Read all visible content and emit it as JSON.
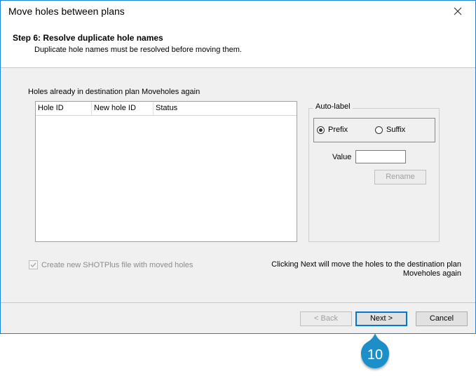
{
  "window": {
    "title": "Move holes between plans"
  },
  "header": {
    "step_title": "Step 6: Resolve duplicate hole names",
    "step_subtitle": "Duplicate hole names must be resolved before moving them."
  },
  "list": {
    "label": "Holes already in destination plan Moveholes again",
    "columns": [
      "Hole ID",
      "New hole ID",
      "Status"
    ],
    "rows": []
  },
  "auto_label": {
    "title": "Auto-label",
    "prefix_label": "Prefix",
    "suffix_label": "Suffix",
    "selected": "Prefix",
    "value_label": "Value",
    "value": "",
    "rename_label": "Rename"
  },
  "create_file": {
    "label": "Create new SHOTPlus file with moved holes",
    "checked": true,
    "enabled": false
  },
  "note": {
    "line1": "Clicking Next will move the holes to the destination plan",
    "line2": "Moveholes again"
  },
  "buttons": {
    "back": "< Back",
    "next": "Next >",
    "cancel": "Cancel"
  },
  "callout": {
    "number": "10",
    "color": "#1c8fc9"
  }
}
